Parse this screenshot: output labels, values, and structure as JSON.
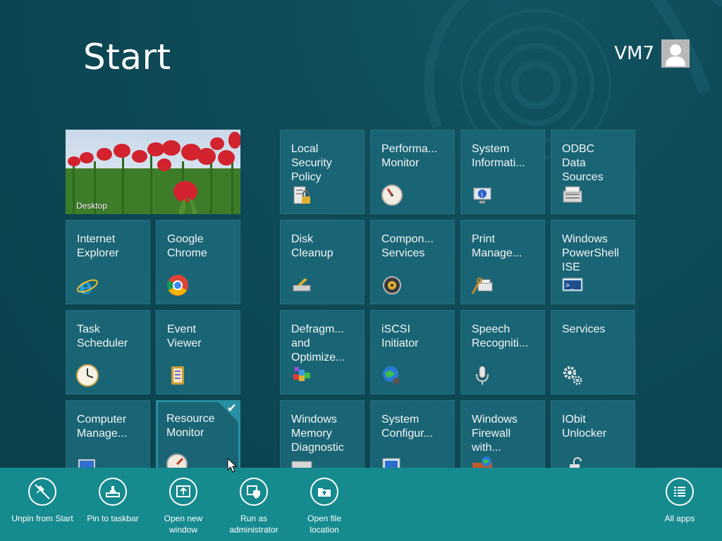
{
  "header": {
    "title": "Start",
    "user_name": "VM7"
  },
  "desktop_tile": {
    "label": "Desktop"
  },
  "tiles": [
    {
      "label": "Internet\nExplorer",
      "icon": "internet-explorer-icon"
    },
    {
      "label": "Google\nChrome",
      "icon": "chrome-icon"
    },
    {
      "label": "Task\nScheduler",
      "icon": "clock-icon"
    },
    {
      "label": "Event\nViewer",
      "icon": "event-viewer-icon"
    },
    {
      "label": "Computer\nManage...",
      "icon": "computer-management-icon"
    },
    {
      "label": "Resource\nMonitor",
      "icon": "resource-monitor-icon",
      "selected": true
    },
    {
      "label": "Local\nSecurity\nPolicy",
      "icon": "security-policy-icon"
    },
    {
      "label": "Performa...\nMonitor",
      "icon": "performance-monitor-icon"
    },
    {
      "label": "System\nInformati...",
      "icon": "system-information-icon"
    },
    {
      "label": "ODBC\nData\nSources",
      "icon": "odbc-icon"
    },
    {
      "label": "Disk\nCleanup",
      "icon": "disk-cleanup-icon"
    },
    {
      "label": "Compon...\nServices",
      "icon": "component-services-icon"
    },
    {
      "label": "Print\nManage...",
      "icon": "print-management-icon"
    },
    {
      "label": "Windows\nPowerShell\nISE",
      "icon": "powershell-icon"
    },
    {
      "label": "Defragm...\nand\nOptimize...",
      "icon": "defrag-icon"
    },
    {
      "label": "iSCSI\nInitiator",
      "icon": "iscsi-icon"
    },
    {
      "label": "Speech\nRecogniti...",
      "icon": "microphone-icon"
    },
    {
      "label": "Services",
      "icon": "gears-icon"
    },
    {
      "label": "Windows\nMemory\nDiagnostic",
      "icon": "memory-diagnostic-icon"
    },
    {
      "label": "System\nConfigur...",
      "icon": "system-configuration-icon"
    },
    {
      "label": "Windows\nFirewall\nwith...",
      "icon": "firewall-icon"
    },
    {
      "label": "IObit\nUnlocker",
      "icon": "unlock-icon"
    }
  ],
  "app_bar": {
    "commands": [
      {
        "label": "Unpin from Start",
        "icon": "unpin-icon"
      },
      {
        "label": "Pin to taskbar",
        "icon": "pin-taskbar-icon"
      },
      {
        "label": "Open new\nwindow",
        "icon": "new-window-icon"
      },
      {
        "label": "Run as\nadministrator",
        "icon": "shield-icon"
      },
      {
        "label": "Open file\nlocation",
        "icon": "folder-icon"
      },
      {
        "label": "All apps",
        "icon": "all-apps-icon"
      }
    ]
  }
}
